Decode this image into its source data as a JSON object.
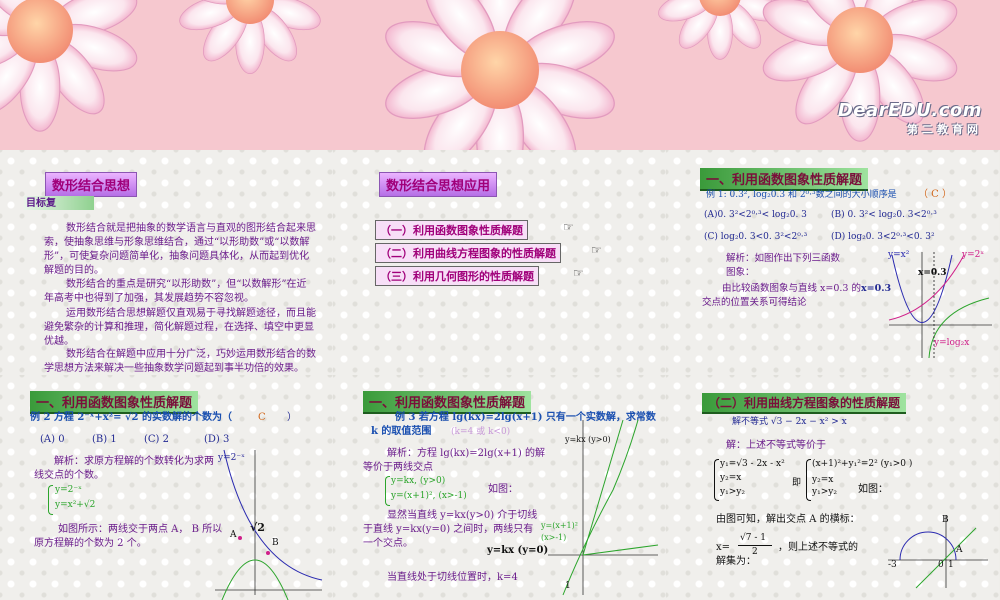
{
  "banner": {
    "brand": "DearEDU.com",
    "brand_sub": "第二教育网"
  },
  "slide1": {
    "title": "数形结合思想",
    "subtitle": "目标复",
    "p1": "数形结合就是把抽象的数学语言与直观的图形结合起来思索，使抽象思维与形象思维结合，通过“以形助数”或“以数解形”，可使复杂问题简单化，抽象问题具体化，从而起到优化解题的目的。",
    "p2": "数形结合的重点是研究“以形助数”，但“以数解形”在近年高考中也得到了加强，其发展趋势不容忽视。",
    "p3": "运用数形结合思想解题仅直观易于寻找解题途径，而且能避免繁杂的计算和推理，简化解题过程，在选择、填空中更显优越。",
    "p4": "数形结合在解题中应用十分广泛，巧妙运用数形结合的数学思想方法来解决一些抽象数学问题起到事半功倍的效果。"
  },
  "slide2": {
    "title": "数形结合思想应用",
    "items": [
      "（一）利用函数图象性质解题",
      "（二）利用曲线方程图象的性质解题",
      "（三）利用几何图形的性质解题"
    ]
  },
  "slide3": {
    "title": "一、利用函数图象性质解题",
    "example": "例 1: 0.3², log₂0.3 和 2⁰·³数之间的大小顺序是",
    "answer": "（ C ）",
    "opt_a": "(A)0. 3²<2⁰·³< log₂0. 3",
    "opt_b": "(B) 0. 3²< log₂0. 3<2⁰·³",
    "opt_c": "(C) log₂0. 3<0. 3²<2⁰·³",
    "opt_d": "(D) log₂0. 3<2⁰·³<0. 3²",
    "sol1": "解析：如图作出下列三函数图象：",
    "sol2": "由比较函数图象与直线 x=0.3 的交点的位置关系可得结论",
    "label_y_x2": "y=x²",
    "label_y_2x": "y=2ˣ",
    "label_x03": "x=0.3",
    "label_ylog": "y=log₂x",
    "inline_x03": "x=0.3"
  },
  "slide4": {
    "title": "一、利用函数图象性质解题",
    "example": "例 2 方程 2⁻ˣ+x²= √2 的实数解的个数为（",
    "answer": "C",
    "close": "）",
    "options": [
      "(A) 0",
      "(B) 1",
      "(C) 2",
      "(D) 3"
    ],
    "sol1": "解析：求原方程解的个数转化为求两线交点的个数。",
    "sys1": "y=2⁻ˣ",
    "sys2": "y=x²+√2",
    "sol2": "如图所示：两线交于两点 A， B 所以原方程解的个数为 2 个。",
    "label_y2x": "y=2⁻ˣ",
    "label_sqrt2": "√2",
    "label_A": "A",
    "label_B": "B"
  },
  "slide5": {
    "title": "一、利用函数图象性质解题",
    "example": "例 3 若方程 lg(kx)=2lg(x+1) 只有一个实数解，求常数 k 的取值范围",
    "hint": "(k=4 或 k<0)",
    "sol1": "解析：方程 lg(kx)=2lg(x+1) 的解等价于两线交点",
    "sys1": "y=kx, (y>0)",
    "sys2": "y=(x+1)², (x>-1)",
    "fig": "如图：",
    "sol2": "显然当直线 y=kx(y>0) 介于切线于直线 y=kx(y=0) 之间时，两线只有一个交点。",
    "sol3": "当直线处于切线位置时，k=4",
    "label_ykx": "y=kx (y>0)",
    "label_parab": "y=(x+1)²",
    "label_parab2": "(x>-1)",
    "label_ykx0": "y=kx (y=0)",
    "label_1": "1"
  },
  "slide6": {
    "title": "（二）利用曲线方程图象的性质解题",
    "example": "解不等式 √3 − 2x − x² > x",
    "sol1": "解：上述不等式等价于",
    "sys1": "y₁=√3 - 2x - x²",
    "sys2": "y₂=x",
    "sys3": "y₁>y₂",
    "ji": "即",
    "sys4": "(x+1)²+y₁²=2² (y₁>0 )",
    "sys5": "y₂=x",
    "sys6": "y₁>y₂",
    "fig": "如图：",
    "sol2": "由图可知，解出交点 A 的横标：",
    "xval": "x=",
    "frac_num": "√7 - 1",
    "frac_den": "2",
    "sol3": "，则上述不等式的",
    "sol4": "解集为：",
    "label_B": "B",
    "label_A": "A",
    "label_m3": "-3",
    "label_0": "0",
    "label_1": "1"
  },
  "colors": {
    "purple_text": "#6b1d8c",
    "blue_text": "#232a93",
    "green_title": "#3a9a3a",
    "answer": "#d2691e"
  }
}
